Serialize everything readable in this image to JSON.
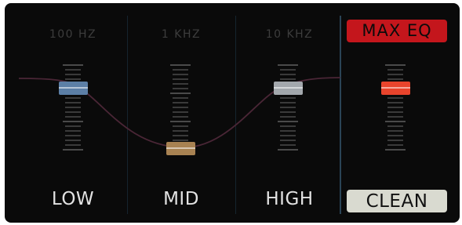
{
  "bands": [
    {
      "id": "low",
      "frequency": "100 HZ",
      "label": "LOW",
      "color": "#5c7fa6"
    },
    {
      "id": "mid",
      "frequency": "1 KHZ",
      "label": "MID",
      "color": "#a88252"
    },
    {
      "id": "high",
      "frequency": "10 KHZ",
      "label": "HIGH",
      "color": "#a3a8ad"
    }
  ],
  "output": {
    "max_eq_label": "MAX EQ",
    "clean_label": "CLEAN",
    "max_eq_color": "#c4161c",
    "clean_color": "#d9dad0",
    "slider_color": "#e8442c"
  },
  "curve_color": "#4a2636"
}
